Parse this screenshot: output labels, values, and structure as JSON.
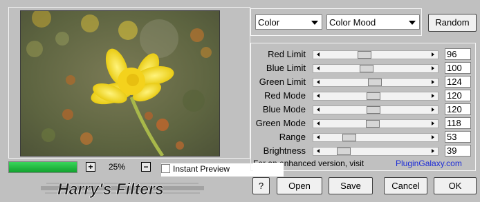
{
  "preview": {
    "zoom": "25%",
    "zoom_in": "+",
    "zoom_out": "−",
    "progress_fraction": 1.0
  },
  "instant_preview": {
    "label": "Instant Preview",
    "checked": false
  },
  "brand": {
    "text": "Harry's Filters"
  },
  "dropdowns": {
    "category": "Color",
    "filter": "Color Mood"
  },
  "buttons": {
    "random": "Random",
    "help": "?",
    "open": "Open",
    "save": "Save",
    "cancel": "Cancel",
    "ok": "OK"
  },
  "sliders": [
    {
      "label": "Red Limit",
      "value": "96"
    },
    {
      "label": "Blue Limit",
      "value": "100"
    },
    {
      "label": "Green Limit",
      "value": "124"
    },
    {
      "label": "Red Mode",
      "value": "120"
    },
    {
      "label": "Blue Mode",
      "value": "120"
    },
    {
      "label": "Green Mode",
      "value": "118"
    },
    {
      "label": "Range",
      "value": "53"
    },
    {
      "label": "Brightness",
      "value": "39"
    }
  ],
  "promo": {
    "text": "For an enhanced version, visit",
    "link": "PluginGalaxy.com"
  },
  "colors": {
    "background": "#c0c0c0",
    "link": "#1b2bd6",
    "progress": "#1fb83d"
  }
}
